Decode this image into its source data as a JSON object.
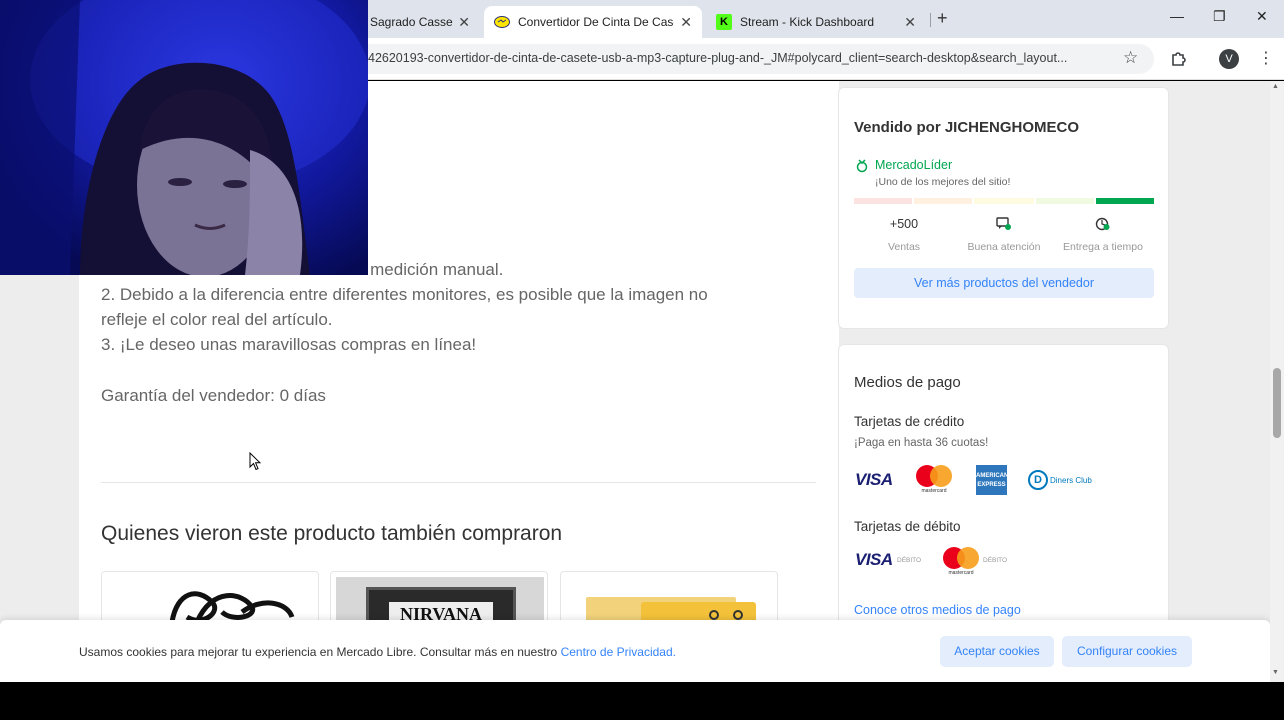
{
  "browser": {
    "tabs": [
      {
        "title": "Sagrado Casse",
        "favicon": "page-icon"
      },
      {
        "title": "Convertidor De Cinta De Casete",
        "favicon": "mercadolibre-icon",
        "active": true
      },
      {
        "title": "Stream - Kick Dashboard",
        "favicon": "kick-icon",
        "favicon_text": "K"
      }
    ],
    "url": "42620193-convertidor-de-cinta-de-casete-usb-a-mp3-capture-plug-and-_JM#polycard_client=search-desktop&search_layout...",
    "profile_initial": "V"
  },
  "description": {
    "line1": "a la medición manual.",
    "line2": "2. Debido a la diferencia entre diferentes monitores, es posible que la imagen no",
    "line3": "refleje el color real del artículo.",
    "line4": "3. ¡Le deseo unas maravillosas compras en línea!",
    "warranty": "Garantía del vendedor: 0 días"
  },
  "related": {
    "title": "Quienes vieron este producto también compraron",
    "items": [
      {
        "image": "cable-image"
      },
      {
        "image": "nirvana-cassette-image",
        "label": "NIRVANA"
      },
      {
        "image": "yellow-cassette-image"
      }
    ]
  },
  "seller": {
    "title": "Vendido por JICHENGHOMECO",
    "badge": "MercadoLíder",
    "badge_sub": "¡Uno de los mejores del sitio!",
    "thermometer_colors": [
      "#fde2e2",
      "#fff0e0",
      "#fffbe0",
      "#f0fae0",
      "#00a650"
    ],
    "metrics": [
      {
        "value": "+500",
        "label": "Ventas",
        "icon": null
      },
      {
        "value": "",
        "label": "Buena atención",
        "icon": "chat-check-icon"
      },
      {
        "value": "",
        "label": "Entrega a tiempo",
        "icon": "clock-check-icon"
      }
    ],
    "more_button": "Ver más productos del vendedor"
  },
  "payment": {
    "title": "Medios de pago",
    "credit_title": "Tarjetas de crédito",
    "credit_note": "¡Paga en hasta 36 cuotas!",
    "debit_title": "Tarjetas de débito",
    "visa": "VISA",
    "mastercard_text": "mastercard",
    "amex_text": "AMERICAN EXPRESS",
    "diners_text": "Diners Club",
    "debit_tag": "DÉBITO",
    "other_link": "Conoce otros medios de pago"
  },
  "cookies": {
    "text": "Usamos cookies para mejorar tu experiencia en Mercado Libre. Consultar más en nuestro",
    "link": "Centro de Privacidad.",
    "accept": "Aceptar cookies",
    "configure": "Configurar cookies"
  },
  "colors": {
    "ml_green": "#00a650",
    "ml_blue": "#3483fa",
    "webcam_blue": "#1219a0"
  }
}
